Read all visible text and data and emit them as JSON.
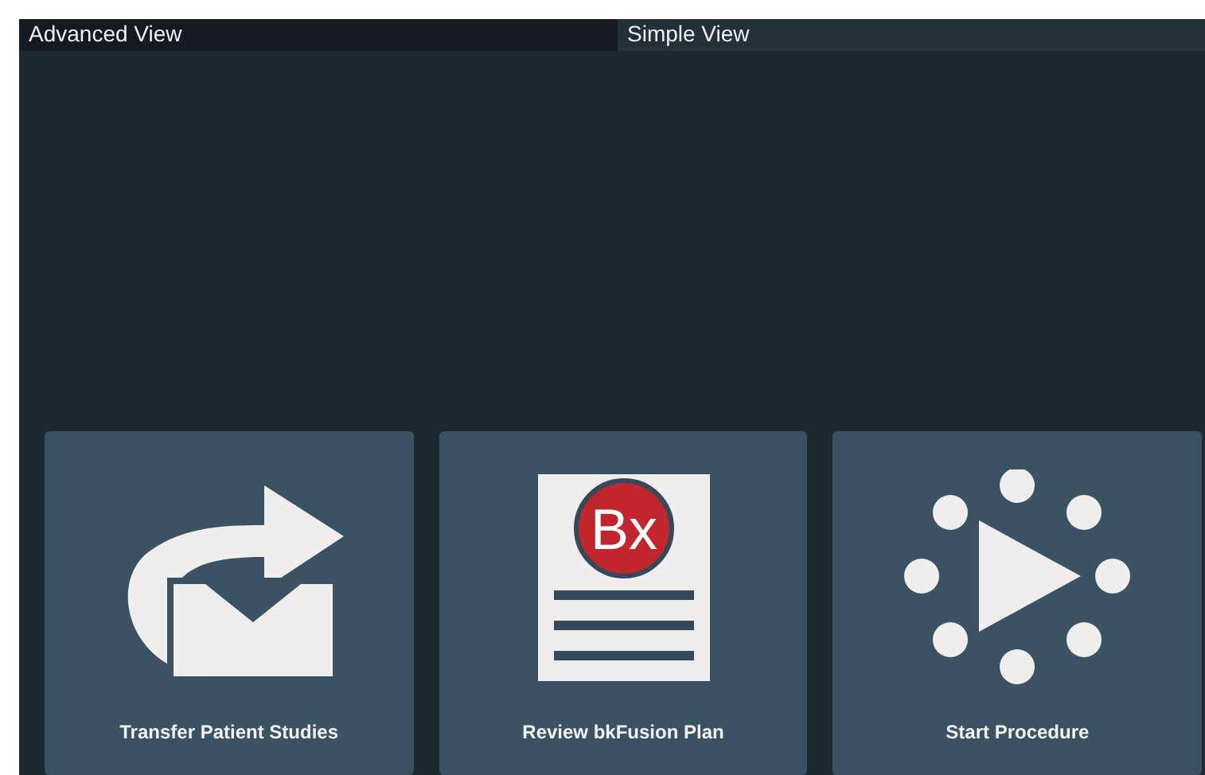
{
  "tabs": [
    {
      "label": "Advanced View",
      "selected": false
    },
    {
      "label": "Simple View",
      "selected": true
    }
  ],
  "tiles": [
    {
      "kind": "transfer",
      "label": "Transfer Patient Studies"
    },
    {
      "kind": "plan",
      "badge": "Bx",
      "label": "Review bkFusion Plan"
    },
    {
      "kind": "start",
      "label": "Start Procedure"
    }
  ]
}
